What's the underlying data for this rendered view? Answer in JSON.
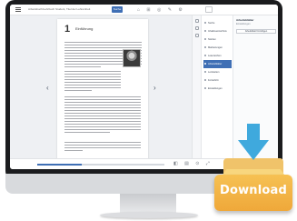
{
  "app": {
    "doc_title": "Arbeitsbuch/Lehrbuch Student, Titel der Lehreinheit",
    "toolbar_button": "Suche",
    "toolbar_icons": "⌂ ⊞ ◎ ✎ ⚙"
  },
  "page": {
    "chapter_number": "1",
    "chapter_title": "Einführung"
  },
  "sidebar": {
    "items": [
      {
        "label": "Suche"
      },
      {
        "label": "Inhaltsverzeichnis"
      },
      {
        "label": "Notizen"
      },
      {
        "label": "Markierungen"
      },
      {
        "label": "Lesezeichen"
      },
      {
        "label": "Arbeitsblätter"
      },
      {
        "label": "Lernkarten"
      },
      {
        "label": "Fortschritt"
      },
      {
        "label": "Einstellungen"
      }
    ],
    "active_index": 5,
    "panel_title": "Arbeitsblätter",
    "panel_subtitle": "Einstellungen",
    "panel_button": "Arbeitsblatt hinzufügen"
  },
  "navigation": {
    "prev": "‹",
    "next": "›",
    "progress_fraction": 0.35,
    "bottom_icons": "◧ ▤ ⊙ ⤢"
  },
  "download": {
    "label": "Download",
    "arrow_color": "#3fa9dd",
    "box_color": "#f2b345"
  },
  "colors": {
    "accent": "#3f6fb5",
    "monitor": "#1b1c1e"
  }
}
